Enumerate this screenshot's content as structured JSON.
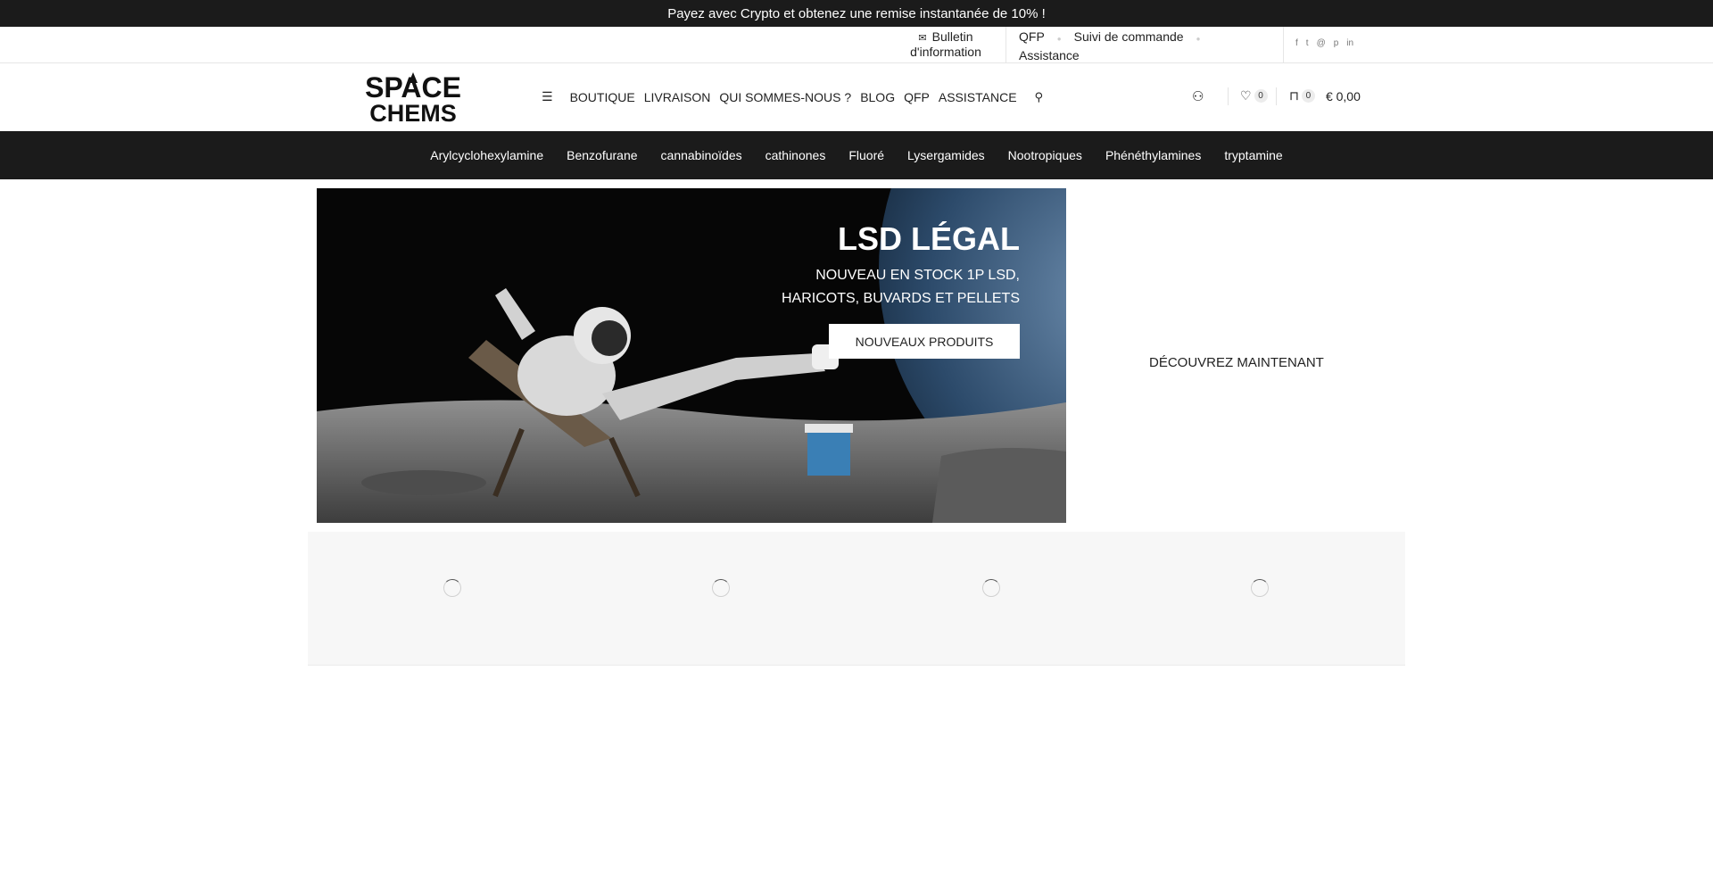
{
  "promo": {
    "text": "Payez avec Crypto et obtenez une remise instantanée de 10% !"
  },
  "topbar": {
    "newsletter_label": "Bulletin d'information",
    "links": [
      "QFP",
      "Suivi de commande",
      "Assistance"
    ]
  },
  "header": {
    "logo_line1": "SPACE",
    "logo_line2": "CHEMS",
    "nav": [
      "BOUTIQUE",
      "LIVRAISON",
      "QUI SOMMES-NOUS ?",
      "BLOG",
      "QFP",
      "ASSISTANCE"
    ],
    "wishlist_count": "0",
    "cart_count": "0",
    "cart_total": "€ 0,00"
  },
  "categories": [
    "Arylcyclohexylamine",
    "Benzofurane",
    "cannabinoïdes",
    "cathinones",
    "Fluoré",
    "Lysergamides",
    "Nootropiques",
    "Phénéthylamines",
    "tryptamine"
  ],
  "hero": {
    "title": "LSD LÉGAL",
    "subtitle": "NOUVEAU EN STOCK 1P LSD, HARICOTS, BUVARDS ET PELLETS",
    "button": "NOUVEAUX PRODUITS"
  },
  "side_link": "DÉCOUVREZ MAINTENANT",
  "icons": {
    "newsletter": "envelope-icon",
    "menu": "hamburger-icon",
    "search": "search-icon",
    "user": "user-icon",
    "wishlist": "heart-icon",
    "cart": "cart-icon",
    "social": [
      "facebook-icon",
      "twitter-icon",
      "email-icon",
      "pinterest-icon",
      "linkedin-icon"
    ]
  },
  "colors": {
    "dark_bar": "#1b1b1b",
    "products_bg": "#f7f7f7"
  }
}
